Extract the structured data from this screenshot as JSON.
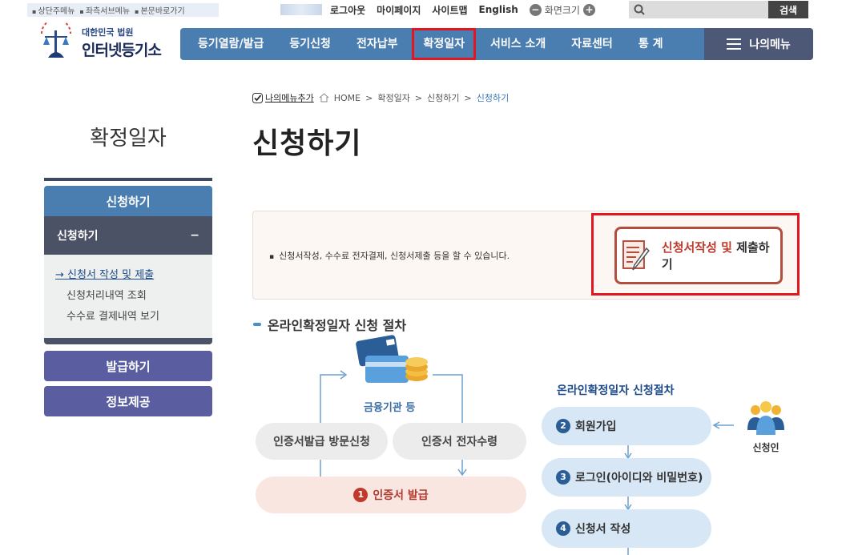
{
  "skip_links": [
    "상단주메뉴",
    "좌측서브메뉴",
    "본문바로가기"
  ],
  "util": {
    "logout": "로그아웃",
    "mypage": "마이페이지",
    "sitemap": "사이트맵",
    "english": "English",
    "zoom_label": "화면크기",
    "zoom_minus": "−",
    "zoom_plus": "+"
  },
  "search": {
    "button": "검색"
  },
  "logo": {
    "line1": "대한민국 법원",
    "line2": "인터넷등기소"
  },
  "gnb": [
    "등기열람/발급",
    "등기신청",
    "전자납부",
    "확정일자",
    "서비스 소개",
    "자료센터",
    "통 계"
  ],
  "gnb_highlight_index": 3,
  "my_menu": "나의메뉴",
  "breadcrumb": {
    "add": "나의메뉴추가",
    "home": "HOME",
    "c1": "확정일자",
    "c2": "신청하기",
    "current": "신청하기",
    "sep": ">"
  },
  "sidebar": {
    "title": "확정일자",
    "section1": "신청하기",
    "sub_title": "신청하기",
    "sub_toggle": "−",
    "items": [
      "신청서 작성 및 제출",
      "신청처리내역 조회",
      "수수료 결제내역 보기"
    ],
    "section2": "발급하기",
    "section3": "정보제공"
  },
  "main": {
    "title": "신청하기",
    "info_text": "신청서작성, 수수료 전자결제, 신청서제출 등을 할 수 있습니다.",
    "apply_part1": "신청서작성 및",
    "apply_part2": "제출하기",
    "process_title": "온라인확정일자 신청 절차"
  },
  "left_flow": {
    "fin": "금융기관 등",
    "visit": "인증서발급 방문신청",
    "elec": "인증서 전자수령",
    "issue_num": "1",
    "issue": "인증서 발급"
  },
  "right_flow": {
    "title": "온라인확정일자 신청절차",
    "steps": [
      {
        "num": "2",
        "label": "회원가입"
      },
      {
        "num": "3",
        "label": "로그인(아이디와 비밀번호)"
      },
      {
        "num": "4",
        "label": "신청서 작성"
      }
    ],
    "applicant": "신청인"
  },
  "colors": {
    "nav_blue": "#4a7db0",
    "my_menu": "#4c5876",
    "highlight_red": "#e3151e",
    "side_purple": "#5a5ea0",
    "step_blue": "#d8e7f5",
    "issue_pink": "#f9e6e1"
  }
}
